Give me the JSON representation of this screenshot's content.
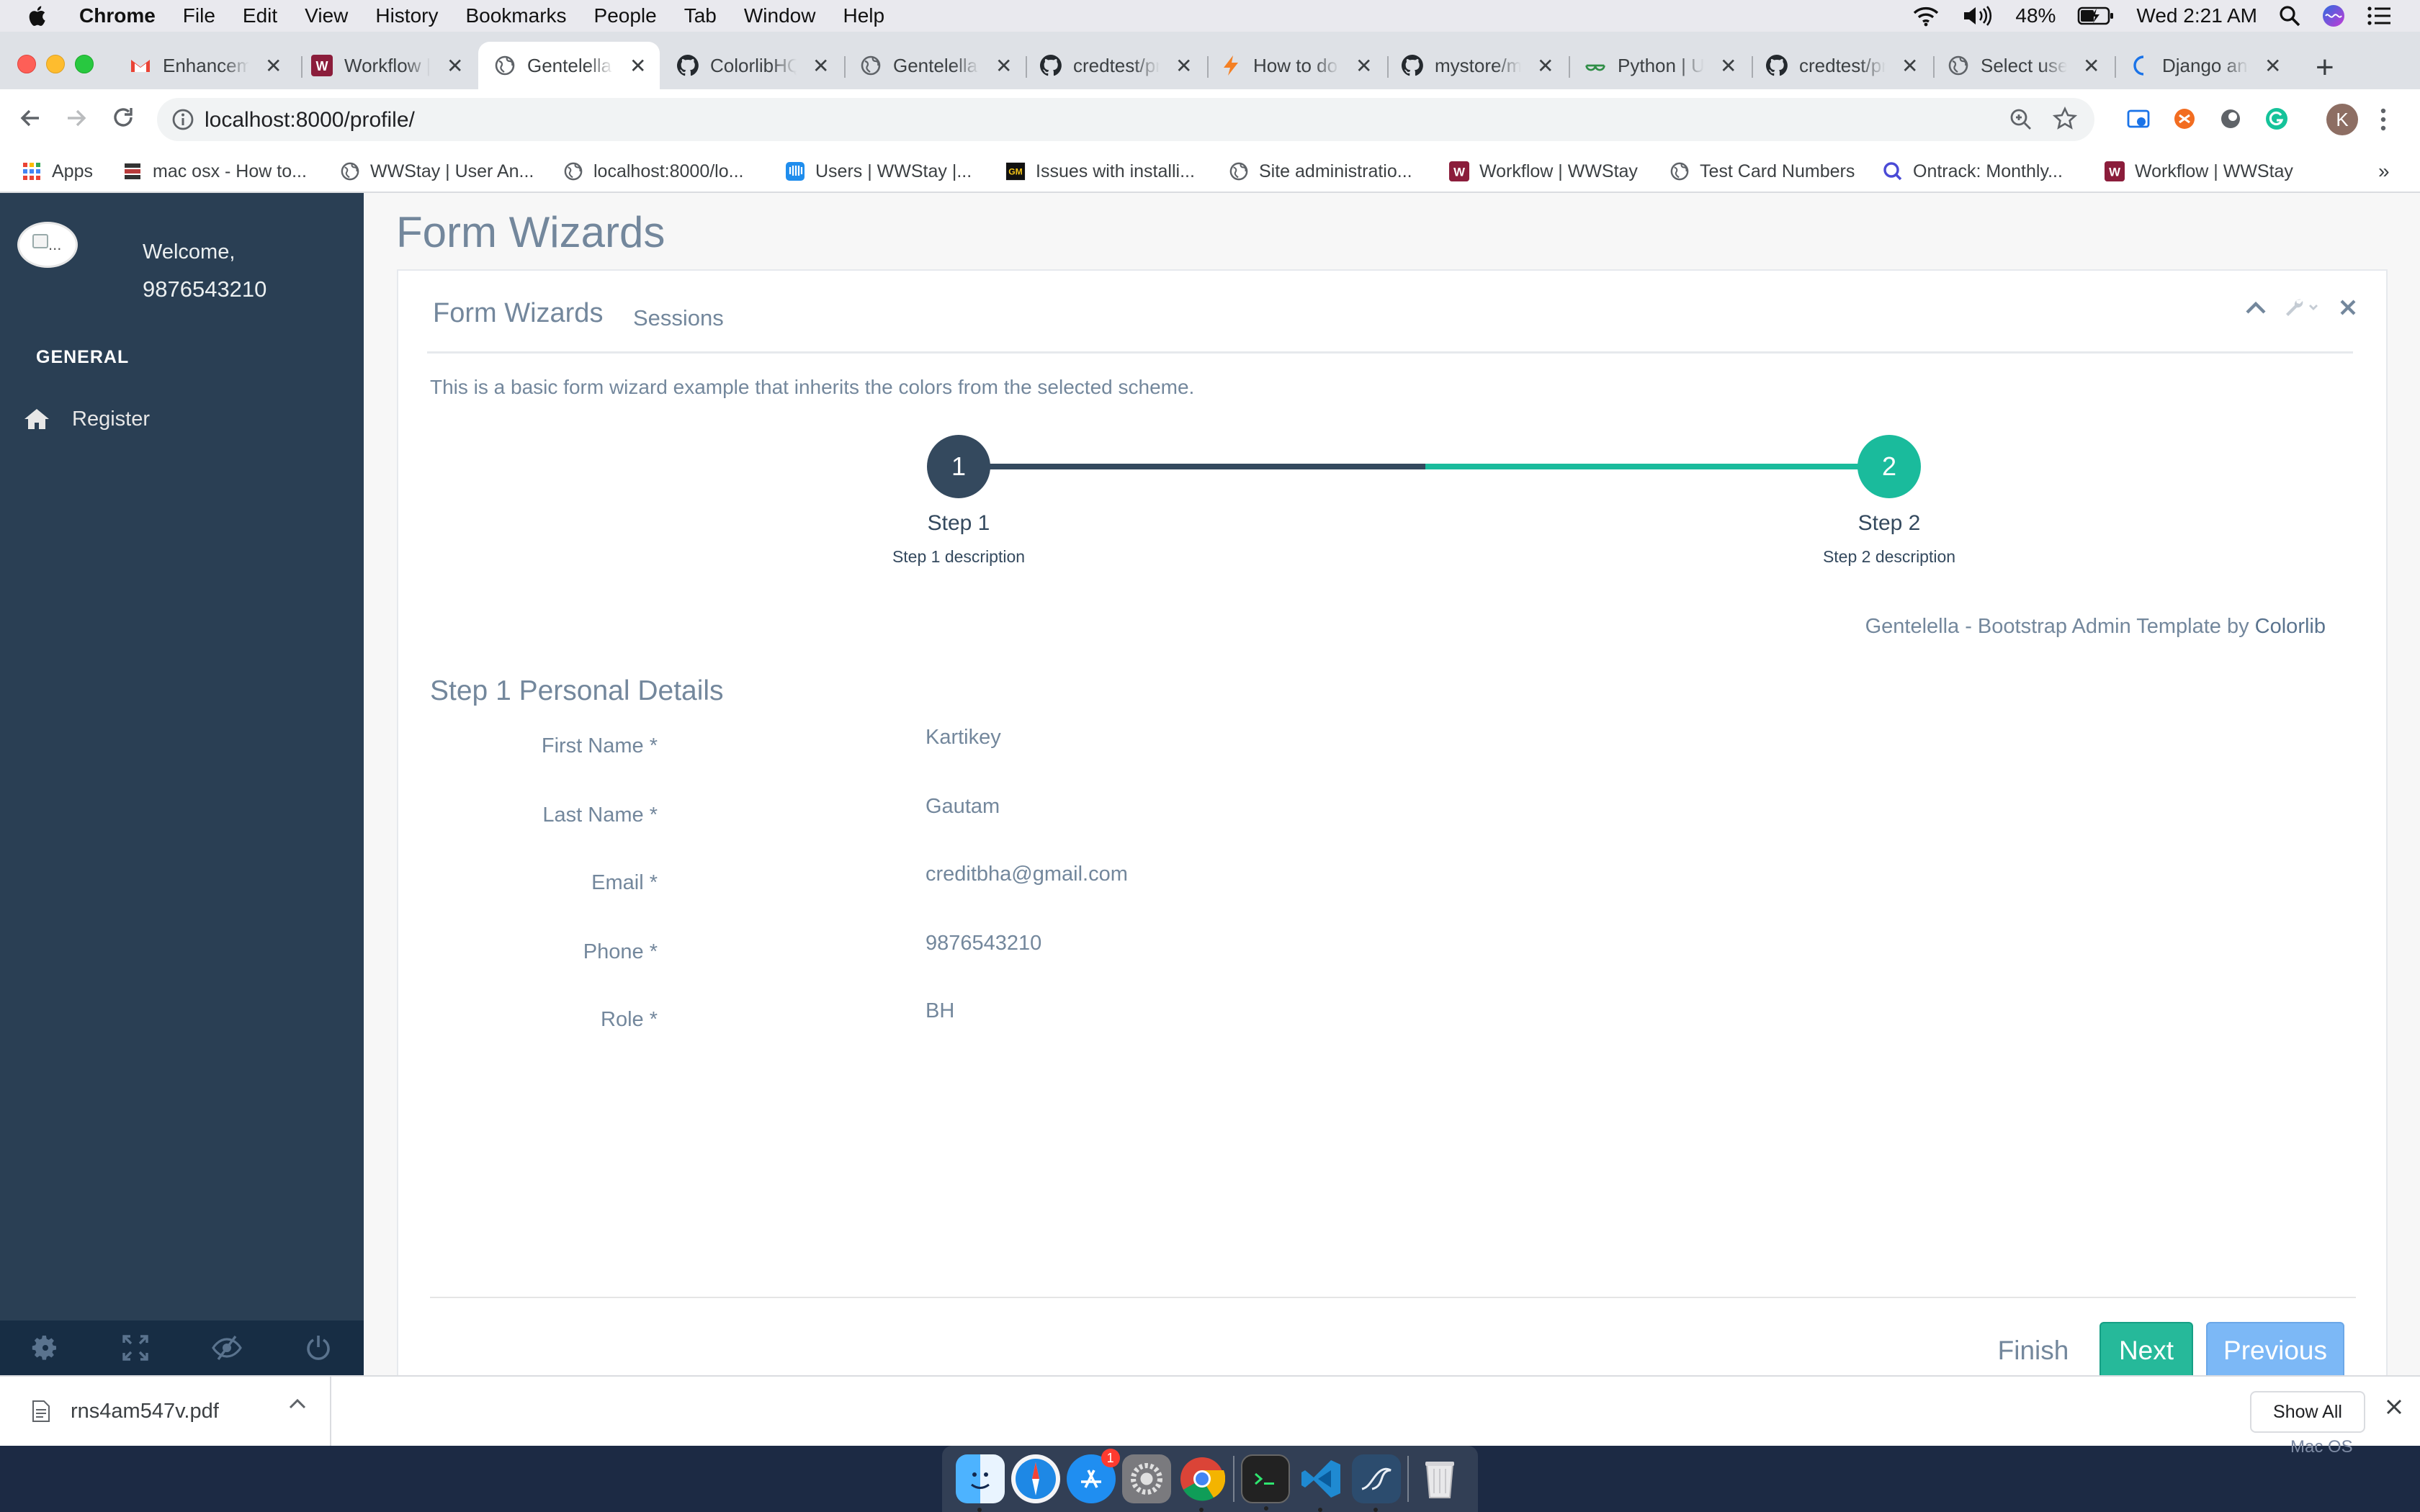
{
  "menubar": {
    "items": [
      "Chrome",
      "File",
      "Edit",
      "View",
      "History",
      "Bookmarks",
      "People",
      "Tab",
      "Window",
      "Help"
    ],
    "battery": "48%",
    "clock": "Wed 2:21 AM"
  },
  "tabs": [
    {
      "title": "Enhancement",
      "icon": "gmail-icon"
    },
    {
      "title": "Workflow | WWStay",
      "icon": "wwstay-icon"
    },
    {
      "title": "Gentelella Alela!",
      "icon": "globe-icon",
      "active": true
    },
    {
      "title": "ColorlibHQ",
      "icon": "github-icon"
    },
    {
      "title": "Gentelella Alela!",
      "icon": "globe-icon"
    },
    {
      "title": "credtest/profile",
      "icon": "github-icon"
    },
    {
      "title": "How to do",
      "icon": "bolt-icon"
    },
    {
      "title": "mystore/main",
      "icon": "github-icon"
    },
    {
      "title": "Python | Update",
      "icon": "geeks-icon"
    },
    {
      "title": "credtest/profile",
      "icon": "github-icon"
    },
    {
      "title": "Select user",
      "icon": "globe-icon"
    },
    {
      "title": "Django and",
      "icon": "django-icon"
    }
  ],
  "address_bar": {
    "url": "localhost:8000/profile/"
  },
  "profile_initial": "K",
  "bookmarks": [
    {
      "label": "Apps",
      "icon": "apps-grid-icon"
    },
    {
      "label": "mac osx - How to...",
      "icon": "stackexchange-icon"
    },
    {
      "label": "WWStay | User An...",
      "icon": "globe-icon"
    },
    {
      "label": "localhost:8000/lo...",
      "icon": "globe-icon"
    },
    {
      "label": "Users | WWStay |...",
      "icon": "intercom-icon"
    },
    {
      "label": "Issues with installi...",
      "icon": "gm-icon"
    },
    {
      "label": "Site administratio...",
      "icon": "globe-icon"
    },
    {
      "label": "Workflow | WWStay",
      "icon": "wwstay-icon"
    },
    {
      "label": "Test Card Numbers",
      "icon": "globe-icon"
    },
    {
      "label": "Ontrack: Monthly...",
      "icon": "ontrack-icon"
    },
    {
      "label": "Workflow | WWStay",
      "icon": "wwstay-icon"
    }
  ],
  "sidebar": {
    "avatar_alt": "...",
    "welcome": "Welcome,",
    "username": "9876543210",
    "section": "GENERAL",
    "nav": [
      {
        "label": "Register",
        "icon": "home-icon"
      }
    ]
  },
  "page": {
    "title": "Form Wizards",
    "panel_title": "Form Wizards",
    "panel_subtitle": "Sessions",
    "description": "This is a basic form wizard example that inherits the colors from the selected scheme.",
    "steps": [
      {
        "number": "1",
        "label": "Step 1",
        "desc": "Step 1 description",
        "color": "#34495e"
      },
      {
        "number": "2",
        "label": "Step 2",
        "desc": "Step 2 description",
        "color": "#1abb9c"
      }
    ],
    "credit_text": "Gentelella - Bootstrap Admin Template by ",
    "credit_link": "Colorlib",
    "section_title": "Step 1 Personal Details",
    "fields": [
      {
        "label": "First Name *",
        "value": "Kartikey"
      },
      {
        "label": "Last Name *",
        "value": "Gautam"
      },
      {
        "label": "Email *",
        "value": "creditbha@gmail.com"
      },
      {
        "label": "Phone *",
        "value": "9876543210"
      },
      {
        "label": "Role *",
        "value": "BH"
      }
    ],
    "buttons": {
      "finish": "Finish",
      "next": "Next",
      "previous": "Previous"
    }
  },
  "downloads": {
    "file": "rns4am547v.pdf",
    "show_all": "Show All"
  },
  "desktop": {
    "label": "Mac OS"
  },
  "dock": {
    "appstore_badge": "1"
  },
  "colors": {
    "sidebar": "#2a3f54",
    "accent_green": "#1abb9c",
    "dark_step": "#34495e",
    "button_next": "#26b99a",
    "button_prev": "#7cb8f6"
  }
}
